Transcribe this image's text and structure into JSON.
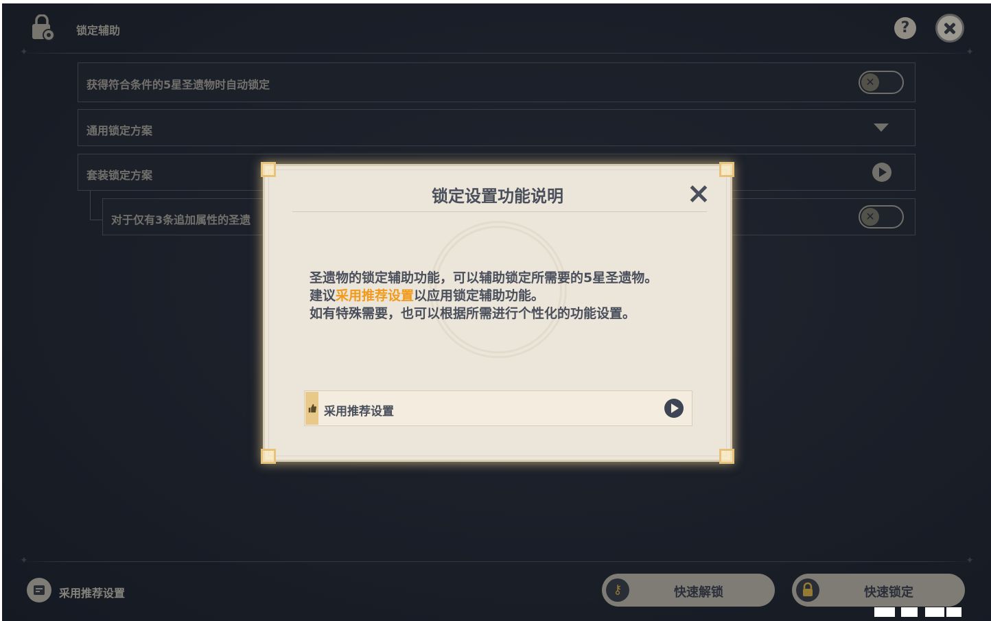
{
  "header": {
    "title": "锁定辅助",
    "lock_icon": "lock-gear-icon",
    "help_label": "?",
    "close_icon": "close-icon"
  },
  "settings": {
    "auto_lock": {
      "label": "获得符合条件的5星圣遗物时自动锁定",
      "toggle_symbol": "✕",
      "enabled": false
    },
    "general_plan": {
      "label": "通用锁定方案",
      "icon": "chevron-down-icon"
    },
    "set_plan": {
      "label": "套装锁定方案",
      "icon": "arrow-right-circle-icon"
    },
    "three_substats": {
      "label": "对于仅有3条追加属性的圣遗",
      "toggle_symbol": "✕",
      "enabled": false
    }
  },
  "modal": {
    "title": "锁定设置功能说明",
    "close_icon": "close-icon",
    "line1": "圣遗物的锁定辅助功能，可以辅助锁定所需要的5星圣遗物。",
    "line2_pre": "建议",
    "line2_highlight": "采用推荐设置",
    "line2_post": "以应用锁定辅助功能。",
    "line3": "如有特殊需要，也可以根据所需进行个性化的功能设置。",
    "recommend_button": {
      "label": "采用推荐设置",
      "icon": "thumbs-up-icon",
      "go_icon": "arrow-right-circle-icon"
    },
    "highlight_color": "#f29a1b"
  },
  "footer": {
    "recommend_label": "采用推荐设置",
    "quick_unlock": {
      "label": "快速解锁",
      "icon": "key-icon"
    },
    "quick_lock": {
      "label": "快速锁定",
      "icon": "lock-icon"
    }
  }
}
